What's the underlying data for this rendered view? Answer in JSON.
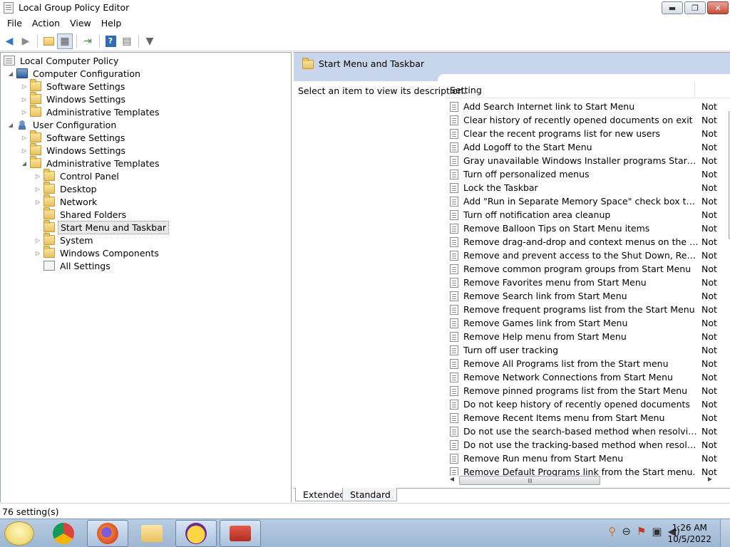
{
  "window": {
    "title": "Local Group Policy Editor",
    "min": "▬",
    "max": "❐",
    "close": "✕"
  },
  "menu": [
    "File",
    "Action",
    "Help"
  ],
  "menu_full": {
    "file": "File",
    "action": "Action",
    "view": "View",
    "help": "Help"
  },
  "toolbar": {
    "back": "◀",
    "forward": "▶",
    "up": "📁",
    "show_hide": "▦",
    "export": "⇥",
    "help": "?",
    "properties": "▤",
    "filter": "▼"
  },
  "tree": {
    "root": "Local Computer Policy",
    "computer_configuration": "Computer Configuration",
    "cc_software_settings": "Software Settings",
    "cc_windows_settings": "Windows Settings",
    "cc_admin_templates": "Administrative Templates",
    "user_configuration": "User Configuration",
    "uc_software_settings": "Software Settings",
    "uc_windows_settings": "Windows Settings",
    "uc_admin_templates": "Administrative Templates",
    "control_panel": "Control Panel",
    "desktop": "Desktop",
    "network": "Network",
    "shared_folders": "Shared Folders",
    "start_menu": "Start Menu and Taskbar",
    "system": "System",
    "windows_components": "Windows Components",
    "all_settings": "All Settings"
  },
  "right": {
    "header_title": "Start Menu and Taskbar",
    "description": "Select an item to view its description.",
    "col_setting": "Setting",
    "settings": [
      {
        "name": "Add Search Internet link to Start Menu",
        "state": "Not"
      },
      {
        "name": "Clear history of recently opened documents on exit",
        "state": "Not"
      },
      {
        "name": "Clear the recent programs list for new users",
        "state": "Not"
      },
      {
        "name": "Add Logoff to the Start Menu",
        "state": "Not"
      },
      {
        "name": "Gray unavailable Windows Installer programs Start Menu sh...",
        "state": "Not"
      },
      {
        "name": "Turn off personalized menus",
        "state": "Not"
      },
      {
        "name": "Lock the Taskbar",
        "state": "Not"
      },
      {
        "name": "Add \"Run in Separate Memory Space\" check box to Run dial...",
        "state": "Not"
      },
      {
        "name": "Turn off notification area cleanup",
        "state": "Not"
      },
      {
        "name": "Remove Balloon Tips on Start Menu items",
        "state": "Not"
      },
      {
        "name": "Remove drag-and-drop and context menus on the Start Me...",
        "state": "Not"
      },
      {
        "name": "Remove and prevent access to the Shut Down, Restart, Sleep...",
        "state": "Not"
      },
      {
        "name": "Remove common program groups from Start Menu",
        "state": "Not"
      },
      {
        "name": "Remove Favorites menu from Start Menu",
        "state": "Not"
      },
      {
        "name": "Remove Search link from Start Menu",
        "state": "Not"
      },
      {
        "name": "Remove frequent programs list from the Start Menu",
        "state": "Not"
      },
      {
        "name": "Remove Games link from Start Menu",
        "state": "Not"
      },
      {
        "name": "Remove Help menu from Start Menu",
        "state": "Not"
      },
      {
        "name": "Turn off user tracking",
        "state": "Not"
      },
      {
        "name": "Remove All Programs list from the Start menu",
        "state": "Not"
      },
      {
        "name": "Remove Network Connections from Start Menu",
        "state": "Not"
      },
      {
        "name": "Remove pinned programs list from the Start Menu",
        "state": "Not"
      },
      {
        "name": "Do not keep history of recently opened documents",
        "state": "Not"
      },
      {
        "name": "Remove Recent Items menu from Start Menu",
        "state": "Not"
      },
      {
        "name": "Do not use the search-based method when resolving shell s...",
        "state": "Not"
      },
      {
        "name": "Do not use the tracking-based method when resolving shell ...",
        "state": "Not"
      },
      {
        "name": "Remove Run menu from Start Menu",
        "state": "Not"
      },
      {
        "name": "Remove Default Programs link from the Start menu.",
        "state": "Not"
      }
    ],
    "tabs": {
      "extended": "Extended",
      "standard": "Standard"
    }
  },
  "status": {
    "text": "76 setting(s)"
  },
  "taskbar": {
    "time": "1:26 AM",
    "date": "10/5/2022",
    "tray_icons": [
      "search-icon",
      "circle-icon",
      "flag-icon",
      "network-icon",
      "volume-icon"
    ],
    "tray_glyphs": [
      "⚲",
      "⊖",
      "⚑",
      "▣",
      "◀)"
    ]
  },
  "icons": {
    "scroll_up": "▲",
    "scroll_down": "▼",
    "scroll_left": "◀",
    "scroll_right": "▶",
    "tree_expand": "▷",
    "tree_collapse": "◢"
  },
  "colors": {
    "header_bg": "#c7d6ea",
    "taskbar_bg": "#9db6d2",
    "close_red": "#c94a36"
  }
}
